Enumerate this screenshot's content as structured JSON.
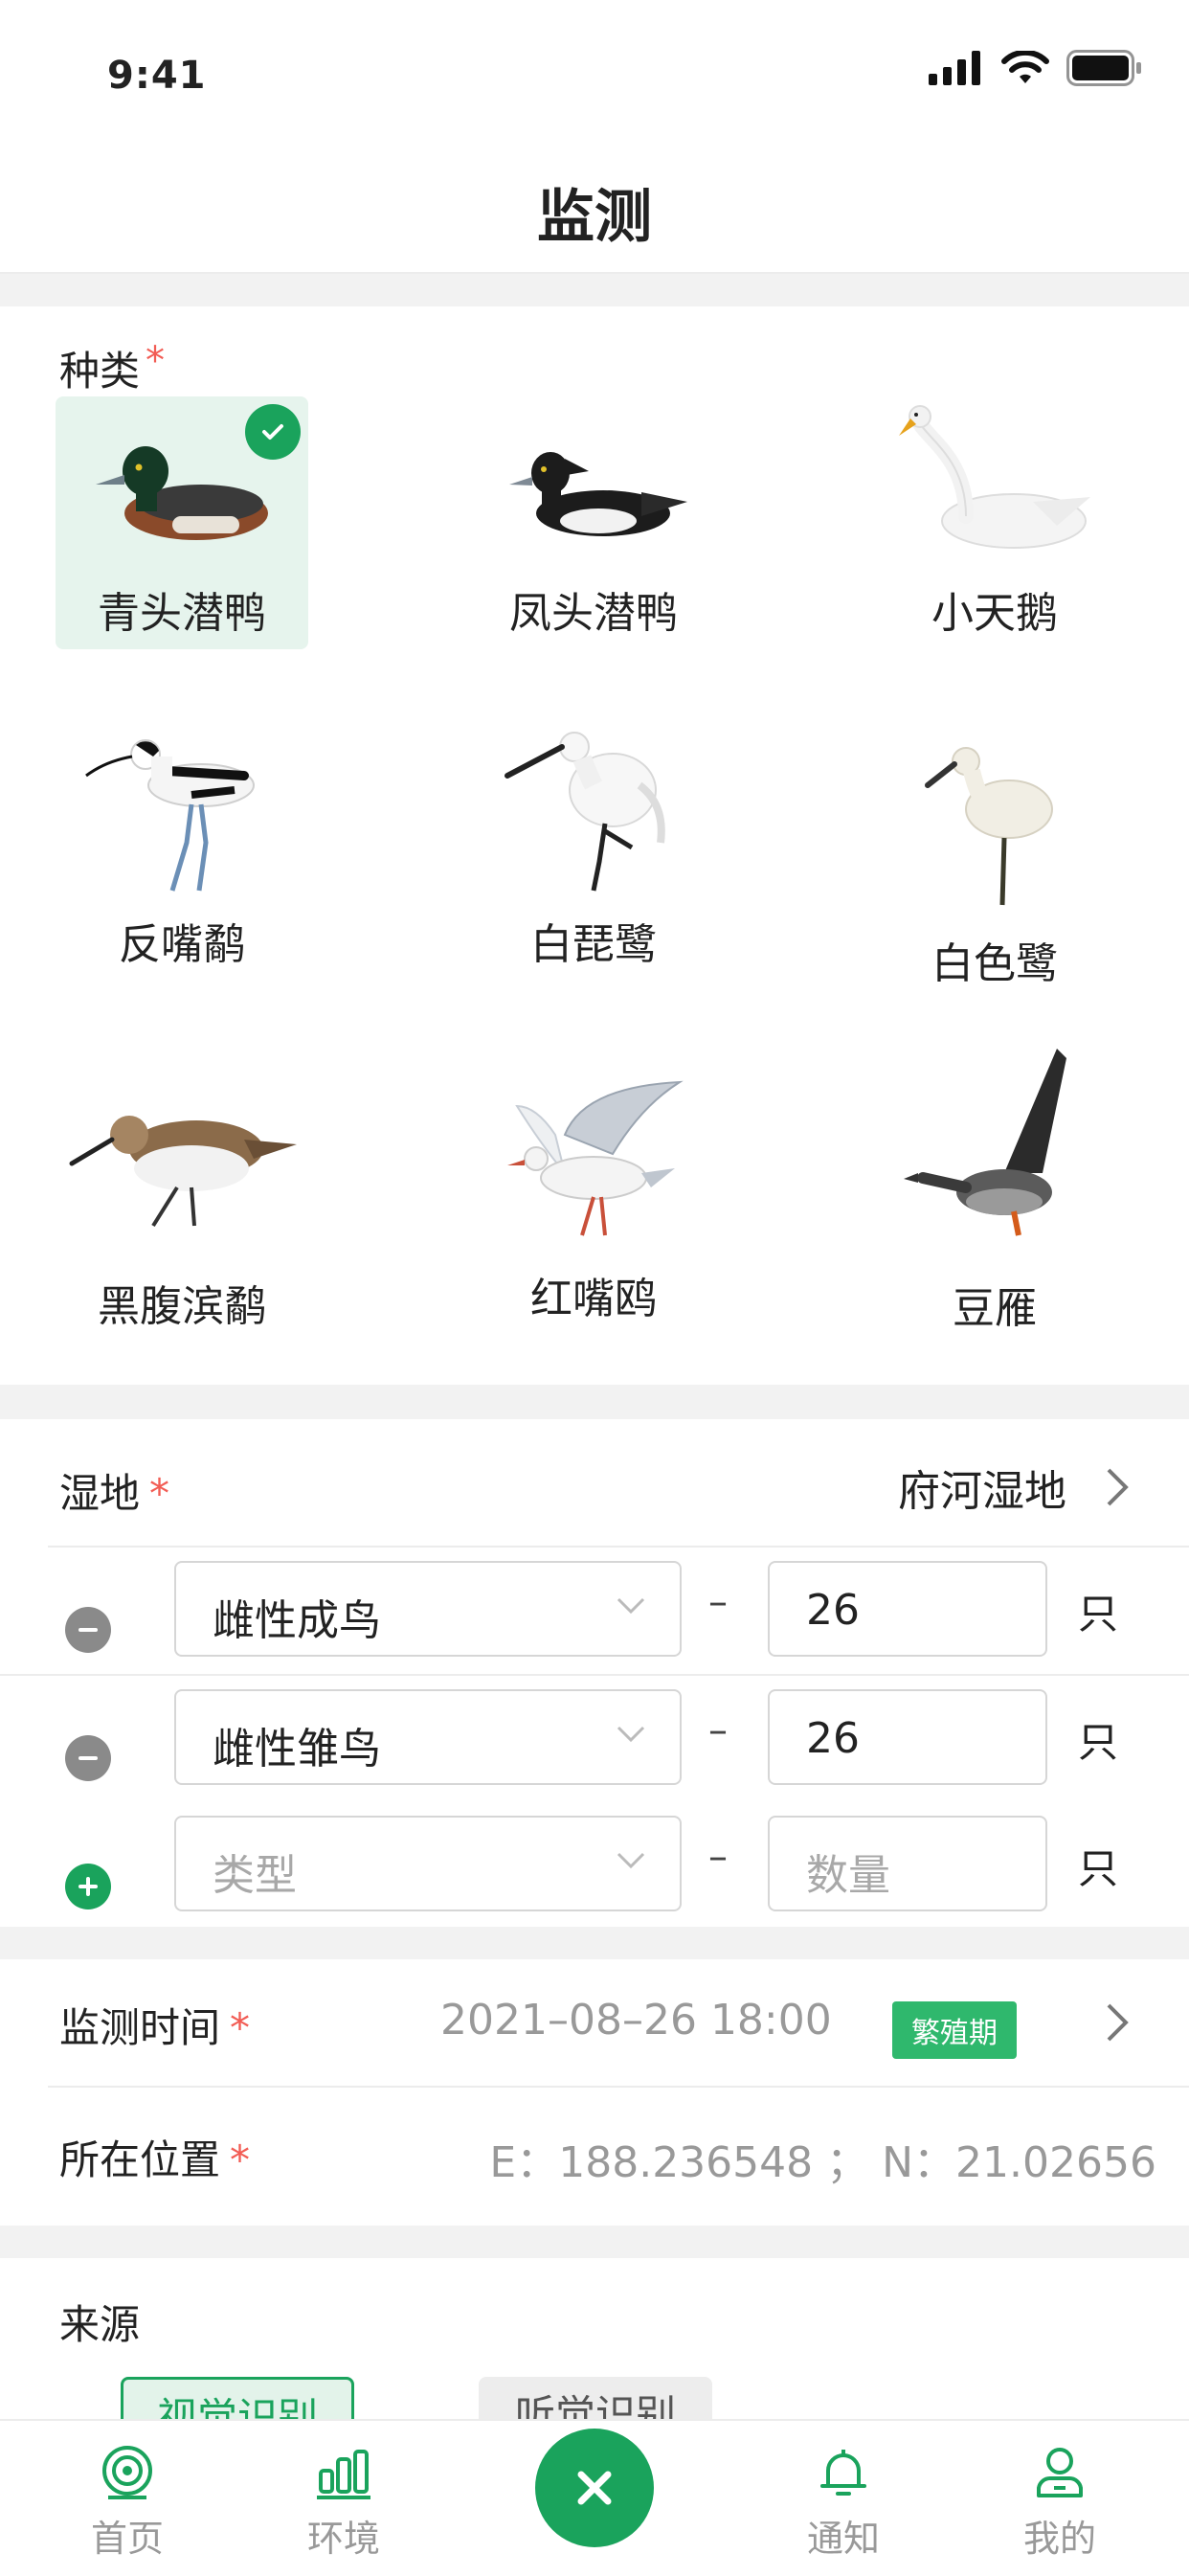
{
  "status_bar": {
    "time": "9:41"
  },
  "header": {
    "title": "监测"
  },
  "species_section": {
    "label": "种类",
    "required_mark": "*",
    "items": [
      {
        "name": "青头潜鸭",
        "selected": true,
        "icon": "duck-icon"
      },
      {
        "name": "凤头潜鸭",
        "selected": false,
        "icon": "duck-icon"
      },
      {
        "name": "小天鹅",
        "selected": false,
        "icon": "swan-icon"
      },
      {
        "name": "反嘴鹬",
        "selected": false,
        "icon": "avocet-icon"
      },
      {
        "name": "白琵鹭",
        "selected": false,
        "icon": "spoonbill-icon"
      },
      {
        "name": "白色鹭",
        "selected": false,
        "icon": "spoonbill-icon"
      },
      {
        "name": "黑腹滨鹬",
        "selected": false,
        "icon": "sandpiper-icon"
      },
      {
        "name": "红嘴鸥",
        "selected": false,
        "icon": "gull-icon"
      },
      {
        "name": "豆雁",
        "selected": false,
        "icon": "goose-icon"
      }
    ]
  },
  "wetland": {
    "label": "湿地",
    "required_mark": "*",
    "value": "府河湿地",
    "rows": [
      {
        "type": "雌性成鸟",
        "count": "26",
        "unit": "只",
        "action": "remove"
      },
      {
        "type": "雌性雏鸟",
        "count": "26",
        "unit": "只",
        "action": "remove"
      },
      {
        "type_placeholder": "类型",
        "count_placeholder": "数量",
        "unit": "只",
        "action": "add"
      }
    ],
    "dash": "–"
  },
  "monitor_time": {
    "label": "监测时间",
    "required_mark": "*",
    "value": "2021–08–26 18:00",
    "badge": "繁殖期"
  },
  "location": {
    "label": "所在位置",
    "required_mark": "*",
    "value": "E：188.236548 ； N：21.02656"
  },
  "source": {
    "label": "来源",
    "options": [
      {
        "label": "视觉识别",
        "active": true
      },
      {
        "label": "听觉识别",
        "active": false
      }
    ]
  },
  "tab_bar": {
    "tabs": [
      {
        "label": "首页",
        "icon": "target-icon"
      },
      {
        "label": "环境",
        "icon": "bar-chart-icon"
      },
      {
        "label": "通知",
        "icon": "bell-icon"
      },
      {
        "label": "我的",
        "icon": "user-icon"
      }
    ],
    "center_icon": "close-icon"
  },
  "colors": {
    "accent": "#1aa35c",
    "required": "#f25c54",
    "selected_bg": "#e6f4ed"
  }
}
